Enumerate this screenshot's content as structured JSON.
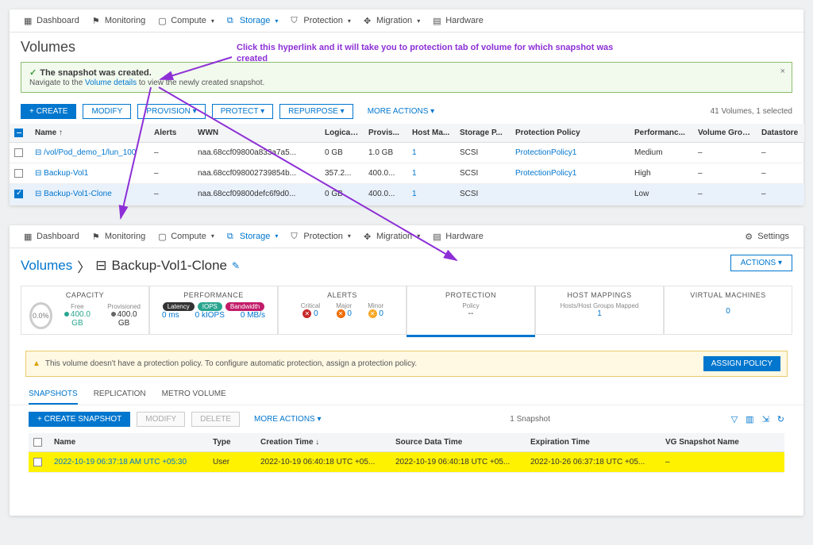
{
  "nav": {
    "items": [
      {
        "label": "Dashboard",
        "dd": false
      },
      {
        "label": "Monitoring",
        "dd": false
      },
      {
        "label": "Compute",
        "dd": true
      },
      {
        "label": "Storage",
        "dd": true,
        "active": true
      },
      {
        "label": "Protection",
        "dd": true
      },
      {
        "label": "Migration",
        "dd": true
      },
      {
        "label": "Hardware",
        "dd": false
      }
    ],
    "settings": "Settings"
  },
  "top": {
    "title": "Volumes",
    "notice": {
      "line1": "The snapshot was created.",
      "line2_a": "Navigate to the ",
      "link": "Volume details",
      "line2_b": " to view the newly created snapshot."
    },
    "buttons": {
      "create": "+  CREATE",
      "modify": "MODIFY",
      "provision": "PROVISION ▾",
      "protect": "PROTECT ▾",
      "repurpose": "REPURPOSE ▾",
      "more": "MORE ACTIONS ▾"
    },
    "count": "41 Volumes, 1 selected",
    "cols": [
      "",
      "Name  ↑",
      "Alerts",
      "WWN",
      "Logical...",
      "Provis...",
      "Host Ma...",
      "Storage P...",
      "Protection Policy",
      "Performanc...",
      "Volume Group",
      "Datastore"
    ],
    "rows": [
      {
        "sel": false,
        "name": "/vol/Pod_demo_1/lun_100",
        "alerts": "–",
        "wwn": "naa.68ccf09800a833a7a5...",
        "log": "0 GB",
        "prov": "1.0 GB",
        "host": "1",
        "sp": "SCSI",
        "pp": "ProtectionPolicy1",
        "perf": "Medium",
        "vg": "–",
        "ds": "–"
      },
      {
        "sel": false,
        "name": "Backup-Vol1",
        "alerts": "–",
        "wwn": "naa.68ccf098002739854b...",
        "log": "357.2...",
        "prov": "400.0...",
        "host": "1",
        "sp": "SCSI",
        "pp": "ProtectionPolicy1",
        "perf": "High",
        "vg": "–",
        "ds": "–"
      },
      {
        "sel": true,
        "name": "Backup-Vol1-Clone",
        "alerts": "–",
        "wwn": "naa.68ccf09800defc6f9d0...",
        "log": "0 GB",
        "prov": "400.0...",
        "host": "1",
        "sp": "SCSI",
        "pp": "",
        "perf": "Low",
        "vg": "–",
        "ds": "–"
      }
    ]
  },
  "bottom": {
    "breadcrumb": {
      "root": "Volumes",
      "leaf": "Backup-Vol1-Clone",
      "sep": "〉",
      "icon": "⊟"
    },
    "actionsBtn": "ACTIONS ▾",
    "cards": {
      "capacity": {
        "title": "CAPACITY",
        "ring": "0.0%",
        "free_lbl": "Free",
        "free": "400.0 GB",
        "prov_lbl": "Provisioned",
        "prov": "400.0 GB"
      },
      "performance": {
        "title": "PERFORMANCE",
        "pills": [
          {
            "text": "Latency",
            "bg": "#333"
          },
          {
            "text": "IOPS",
            "bg": "#2aa58f"
          },
          {
            "text": "Bandwidth",
            "bg": "#c21b69"
          }
        ],
        "vals": [
          "0 ms",
          "0 kIOPS",
          "0 MB/s"
        ]
      },
      "alerts": {
        "title": "ALERTS",
        "items": [
          {
            "label": "Critical",
            "val": "0",
            "color": "#c62828"
          },
          {
            "label": "Major",
            "val": "0",
            "color": "#ef6c00"
          },
          {
            "label": "Minor",
            "val": "0",
            "color": "#f9a825"
          }
        ]
      },
      "protection": {
        "title": "PROTECTION",
        "policy_lbl": "Policy",
        "policy_val": "--"
      },
      "hostmap": {
        "title": "HOST MAPPINGS",
        "lbl": "Hosts/Host Groups Mapped",
        "val": "1"
      },
      "vm": {
        "title": "VIRTUAL MACHINES",
        "val": "0"
      }
    },
    "assign": {
      "text": "This volume doesn't have a protection policy. To configure automatic protection, assign a protection policy.",
      "btn": "ASSIGN POLICY"
    },
    "tabs": [
      "SNAPSHOTS",
      "REPLICATION",
      "METRO VOLUME"
    ],
    "subbtns": {
      "create": "+  CREATE SNAPSHOT",
      "modify": "MODIFY",
      "delete": "DELETE",
      "more": "MORE ACTIONS ▾"
    },
    "snapCount": "1 Snapshot",
    "snapCols": [
      "",
      "Name",
      "Type",
      "Creation Time  ↓",
      "Source Data Time",
      "Expiration Time",
      "VG Snapshot Name"
    ],
    "snapRow": {
      "name": "2022-10-19 06:37:18 AM UTC +05:30",
      "type": "User",
      "ctime": "2022-10-19 06:40:18 UTC +05...",
      "stime": "2022-10-19 06:40:18 UTC +05...",
      "etime": "2022-10-26 06:37:18 UTC +05...",
      "vg": "–"
    }
  },
  "annotation": {
    "text": "Click this hyperlink  and it will take you to protection tab of volume for which snapshot was created"
  }
}
